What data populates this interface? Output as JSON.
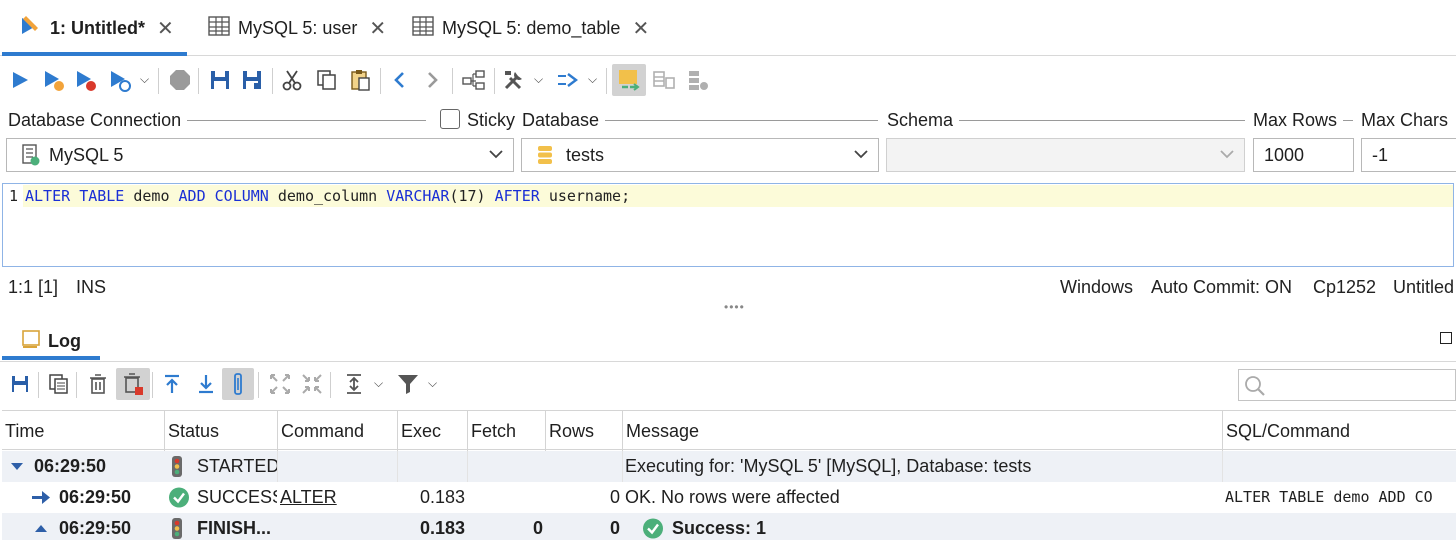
{
  "tabs": [
    {
      "label": "1: Untitled*",
      "icon": "sql-editor-icon",
      "active": true
    },
    {
      "label": "MySQL 5: user",
      "icon": "table-grid-icon",
      "active": false
    },
    {
      "label": "MySQL 5: demo_table",
      "icon": "table-grid-icon",
      "active": false
    }
  ],
  "connection": {
    "db_connection_label": "Database Connection",
    "db_connection_value": "MySQL 5",
    "sticky_label": "Sticky",
    "database_label": "Database",
    "database_value": "tests",
    "schema_label": "Schema",
    "schema_value": "",
    "max_rows_label": "Max Rows",
    "max_rows_value": "1000",
    "max_chars_label": "Max Chars",
    "max_chars_value": "-1"
  },
  "editor": {
    "line_number": "1",
    "sql": "ALTER TABLE demo ADD COLUMN demo_column VARCHAR(17) AFTER username;"
  },
  "statusbar": {
    "position": "1:1 [1]",
    "mode": "INS",
    "line_endings": "Windows",
    "auto_commit": "Auto Commit: ON",
    "encoding": "Cp1252",
    "file": "Untitled"
  },
  "log": {
    "tab_label": "Log",
    "columns": [
      "Time",
      "Status",
      "Command",
      "Exec",
      "Fetch",
      "Rows",
      "Message",
      "SQL/Command"
    ],
    "rows": [
      {
        "time": "06:29:50",
        "status": "STARTED",
        "command": "",
        "exec": "",
        "fetch": "",
        "rows": "",
        "message": "Executing for: 'MySQL 5' [MySQL], Database: tests",
        "sql": ""
      },
      {
        "time": "06:29:50",
        "status": "SUCCESS",
        "command": "ALTER",
        "exec": "0.183",
        "fetch": "",
        "rows": "0",
        "message": "OK. No rows were affected",
        "sql": "ALTER TABLE demo ADD CO"
      },
      {
        "time": "06:29:50",
        "status": "FINISH...",
        "command": "",
        "exec": "0.183",
        "fetch": "0",
        "rows": "0",
        "message": "Success: 1",
        "sql": ""
      }
    ]
  },
  "colors": {
    "accent": "#2e7bcf",
    "success": "#4caf7a",
    "keyword": "#1a2fd6"
  }
}
